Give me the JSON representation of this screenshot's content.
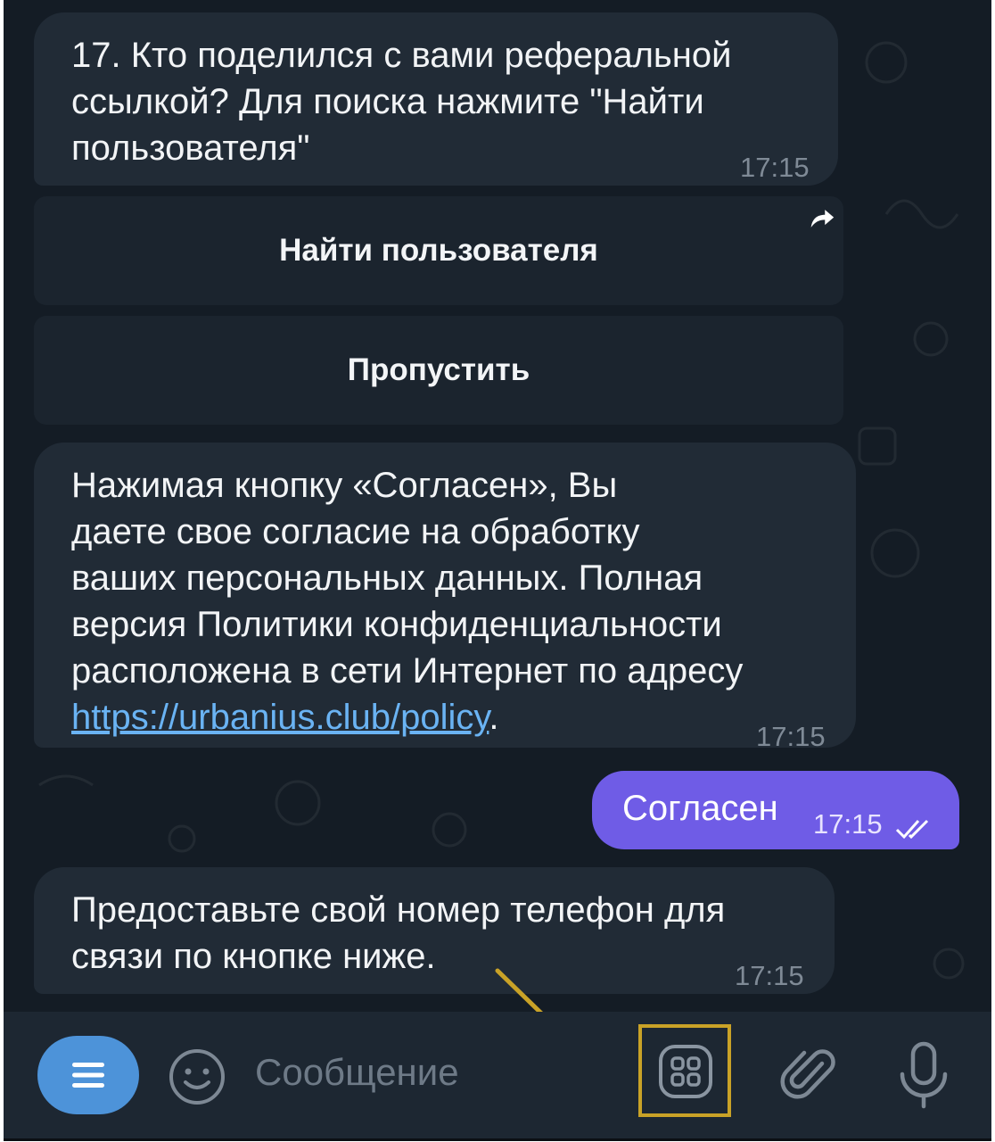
{
  "messages": [
    {
      "text": "17. Кто поделился с вами реферальной\nссылкой? Для поиска нажмите \"Найти\nпользователя\"",
      "time": "17:15"
    },
    {
      "text": "Нажимая кнопку «Согласен», Вы\nдаете свое согласие на обработку\nваших персональных данных. Полная\nверсия Политики конфиденциальности\nрасположена в сети Интернет по адресу",
      "link": "https://urbanius.club/policy",
      "link_suffix": ".",
      "time": "17:15"
    },
    {
      "text": "Предоставьте свой номер телефон для\nсвязи по кнопке ниже.",
      "time": "17:15"
    }
  ],
  "inline_buttons": [
    "Найти пользователя",
    "Пропустить"
  ],
  "outgoing": {
    "text": "Согласен",
    "time": "17:15",
    "status": "read-double-check"
  },
  "input": {
    "placeholder": "Сообщение"
  },
  "icons": [
    "forward-icon",
    "menu-icon",
    "emoji-icon",
    "bot-keyboard-icon",
    "attach-icon",
    "microphone-icon",
    "double-check-icon"
  ],
  "colors": {
    "background": "#141c25",
    "incoming_bubble": "#212b36",
    "outgoing_bubble": "#6f5ce6",
    "accent": "#4d93d9",
    "link": "#6ab3f3",
    "highlight": "#c9a227"
  }
}
